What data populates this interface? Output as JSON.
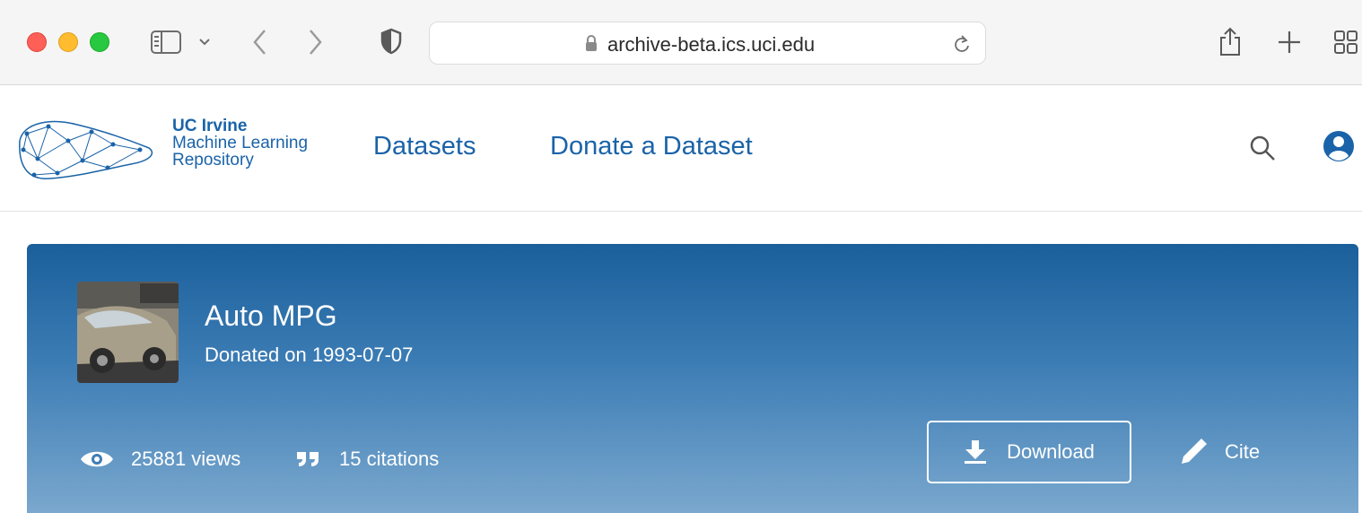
{
  "browser": {
    "url": "archive-beta.ics.uci.edu",
    "icons": [
      "sidebar-icon",
      "chevron-down-icon",
      "back-icon",
      "forward-icon",
      "shield-icon",
      "lock-icon",
      "reload-icon",
      "share-icon",
      "new-tab-icon",
      "tab-overview-icon"
    ]
  },
  "site": {
    "logo": {
      "line1": "UC Irvine",
      "line2": "Machine Learning",
      "line3": "Repository"
    },
    "nav": {
      "datasets": "Datasets",
      "donate": "Donate a Dataset"
    },
    "icons": [
      "search-icon",
      "account-icon"
    ],
    "colors": {
      "brand": "#1a63a8"
    }
  },
  "dataset": {
    "title": "Auto MPG",
    "donated": "Donated on 1993-07-07",
    "views": "25881 views",
    "citations": "15 citations",
    "download_label": "Download",
    "cite_label": "Cite"
  }
}
